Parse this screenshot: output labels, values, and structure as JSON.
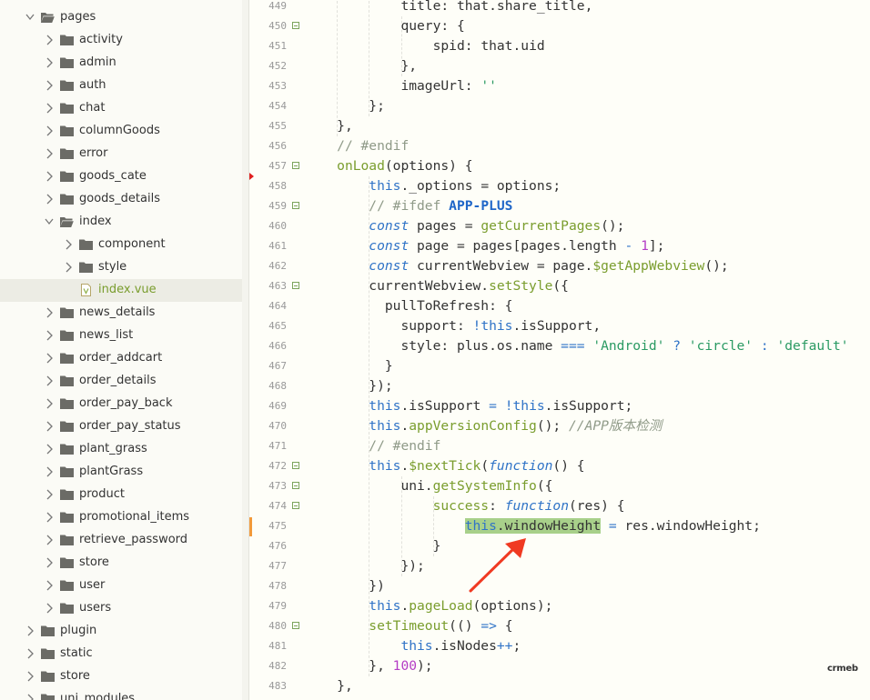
{
  "sidebar": {
    "items": [
      {
        "label": "pages",
        "level": 1,
        "type": "folder",
        "state": "expanded"
      },
      {
        "label": "activity",
        "level": 2,
        "type": "folder",
        "state": "collapsed"
      },
      {
        "label": "admin",
        "level": 2,
        "type": "folder",
        "state": "collapsed"
      },
      {
        "label": "auth",
        "level": 2,
        "type": "folder",
        "state": "collapsed"
      },
      {
        "label": "chat",
        "level": 2,
        "type": "folder",
        "state": "collapsed"
      },
      {
        "label": "columnGoods",
        "level": 2,
        "type": "folder",
        "state": "collapsed"
      },
      {
        "label": "error",
        "level": 2,
        "type": "folder",
        "state": "collapsed"
      },
      {
        "label": "goods_cate",
        "level": 2,
        "type": "folder",
        "state": "collapsed"
      },
      {
        "label": "goods_details",
        "level": 2,
        "type": "folder",
        "state": "collapsed"
      },
      {
        "label": "index",
        "level": 2,
        "type": "folder",
        "state": "expanded"
      },
      {
        "label": "component",
        "level": 3,
        "type": "folder",
        "state": "collapsed"
      },
      {
        "label": "style",
        "level": 3,
        "type": "folder",
        "state": "collapsed"
      },
      {
        "label": "index.vue",
        "level": 3,
        "type": "file",
        "state": "selected"
      },
      {
        "label": "news_details",
        "level": 2,
        "type": "folder",
        "state": "collapsed"
      },
      {
        "label": "news_list",
        "level": 2,
        "type": "folder",
        "state": "collapsed"
      },
      {
        "label": "order_addcart",
        "level": 2,
        "type": "folder",
        "state": "collapsed"
      },
      {
        "label": "order_details",
        "level": 2,
        "type": "folder",
        "state": "collapsed"
      },
      {
        "label": "order_pay_back",
        "level": 2,
        "type": "folder",
        "state": "collapsed"
      },
      {
        "label": "order_pay_status",
        "level": 2,
        "type": "folder",
        "state": "collapsed"
      },
      {
        "label": "plant_grass",
        "level": 2,
        "type": "folder",
        "state": "collapsed"
      },
      {
        "label": "plantGrass",
        "level": 2,
        "type": "folder",
        "state": "collapsed"
      },
      {
        "label": "product",
        "level": 2,
        "type": "folder",
        "state": "collapsed"
      },
      {
        "label": "promotional_items",
        "level": 2,
        "type": "folder",
        "state": "collapsed"
      },
      {
        "label": "retrieve_password",
        "level": 2,
        "type": "folder",
        "state": "collapsed"
      },
      {
        "label": "store",
        "level": 2,
        "type": "folder",
        "state": "collapsed"
      },
      {
        "label": "user",
        "level": 2,
        "type": "folder",
        "state": "collapsed"
      },
      {
        "label": "users",
        "level": 2,
        "type": "folder",
        "state": "collapsed"
      },
      {
        "label": "plugin",
        "level": 1,
        "type": "folder",
        "state": "collapsed"
      },
      {
        "label": "static",
        "level": 1,
        "type": "folder",
        "state": "collapsed"
      },
      {
        "label": "store",
        "level": 1,
        "type": "folder",
        "state": "collapsed"
      },
      {
        "label": "uni_modules",
        "level": 1,
        "type": "folder",
        "state": "collapsed"
      }
    ]
  },
  "editor": {
    "lines": [
      {
        "num": "449",
        "fold": false,
        "tokens": [
          [
            "            ",
            ""
          ],
          [
            "title",
            ""
          ],
          [
            ": ",
            ""
          ],
          [
            "that",
            ""
          ],
          [
            ".",
            ""
          ],
          [
            "share_title",
            ""
          ],
          [
            ",",
            ""
          ]
        ]
      },
      {
        "num": "450",
        "fold": true,
        "tokens": [
          [
            "            ",
            ""
          ],
          [
            "query",
            ""
          ],
          [
            ": {",
            ""
          ]
        ]
      },
      {
        "num": "451",
        "fold": false,
        "tokens": [
          [
            "                ",
            ""
          ],
          [
            "spid",
            ""
          ],
          [
            ": ",
            ""
          ],
          [
            "that",
            ""
          ],
          [
            ".",
            ""
          ],
          [
            "uid",
            ""
          ]
        ]
      },
      {
        "num": "452",
        "fold": false,
        "tokens": [
          [
            "            ",
            ""
          ],
          [
            "},",
            ""
          ]
        ]
      },
      {
        "num": "453",
        "fold": false,
        "tokens": [
          [
            "            ",
            ""
          ],
          [
            "imageUrl",
            ""
          ],
          [
            ": ",
            ""
          ],
          [
            "''",
            "t-str"
          ]
        ]
      },
      {
        "num": "454",
        "fold": false,
        "tokens": [
          [
            "        ",
            ""
          ],
          [
            "};",
            ""
          ]
        ]
      },
      {
        "num": "455",
        "fold": false,
        "tokens": [
          [
            "    ",
            ""
          ],
          [
            "},",
            ""
          ]
        ]
      },
      {
        "num": "456",
        "fold": false,
        "tokens": [
          [
            "    ",
            ""
          ],
          [
            "// #endif",
            "t-cmt"
          ]
        ]
      },
      {
        "num": "457",
        "fold": true,
        "tokens": [
          [
            "    ",
            ""
          ],
          [
            "onLoad",
            "t-fn"
          ],
          [
            "(options) {",
            ""
          ]
        ]
      },
      {
        "num": "458",
        "fold": false,
        "tokens": [
          [
            "        ",
            ""
          ],
          [
            "this",
            "t-kw"
          ],
          [
            "._options = options;",
            ""
          ]
        ]
      },
      {
        "num": "459",
        "fold": true,
        "tokens": [
          [
            "        ",
            ""
          ],
          [
            "// #ifdef ",
            "t-cmt"
          ],
          [
            "APP-PLUS",
            "t-pre"
          ]
        ]
      },
      {
        "num": "460",
        "fold": false,
        "tokens": [
          [
            "        ",
            ""
          ],
          [
            "const",
            "t-kwi"
          ],
          [
            " pages = ",
            ""
          ],
          [
            "getCurrentPages",
            "t-fn"
          ],
          [
            "();",
            ""
          ]
        ]
      },
      {
        "num": "461",
        "fold": false,
        "tokens": [
          [
            "        ",
            ""
          ],
          [
            "const",
            "t-kwi"
          ],
          [
            " page = pages[pages.length ",
            ""
          ],
          [
            "-",
            "t-op"
          ],
          [
            " ",
            ""
          ],
          [
            "1",
            "t-num"
          ],
          [
            "];",
            ""
          ]
        ]
      },
      {
        "num": "462",
        "fold": false,
        "tokens": [
          [
            "        ",
            ""
          ],
          [
            "const",
            "t-kwi"
          ],
          [
            " currentWebview = page.",
            ""
          ],
          [
            "$getAppWebview",
            "t-fn"
          ],
          [
            "();",
            ""
          ]
        ]
      },
      {
        "num": "463",
        "fold": true,
        "tokens": [
          [
            "        ",
            ""
          ],
          [
            "currentWebview.",
            ""
          ],
          [
            "setStyle",
            "t-fn"
          ],
          [
            "({",
            ""
          ]
        ]
      },
      {
        "num": "464",
        "fold": false,
        "tokens": [
          [
            "          ",
            ""
          ],
          [
            "pullToRefresh: {",
            ""
          ]
        ]
      },
      {
        "num": "465",
        "fold": false,
        "tokens": [
          [
            "            ",
            ""
          ],
          [
            "support: ",
            ""
          ],
          [
            "!",
            "t-op"
          ],
          [
            "this",
            "t-kw"
          ],
          [
            ".isSupport,",
            ""
          ]
        ]
      },
      {
        "num": "466",
        "fold": false,
        "tokens": [
          [
            "            ",
            ""
          ],
          [
            "style: plus.os.name ",
            ""
          ],
          [
            "===",
            "t-op"
          ],
          [
            " ",
            ""
          ],
          [
            "'Android'",
            "t-str"
          ],
          [
            " ",
            ""
          ],
          [
            "?",
            "t-op"
          ],
          [
            " ",
            ""
          ],
          [
            "'circle'",
            "t-str"
          ],
          [
            " ",
            ""
          ],
          [
            ":",
            "t-op"
          ],
          [
            " ",
            ""
          ],
          [
            "'default'",
            "t-str"
          ]
        ]
      },
      {
        "num": "467",
        "fold": false,
        "tokens": [
          [
            "          ",
            ""
          ],
          [
            "}",
            ""
          ]
        ]
      },
      {
        "num": "468",
        "fold": false,
        "tokens": [
          [
            "        ",
            ""
          ],
          [
            "});",
            ""
          ]
        ]
      },
      {
        "num": "469",
        "fold": false,
        "tokens": [
          [
            "        ",
            ""
          ],
          [
            "this",
            "t-kw"
          ],
          [
            ".isSupport ",
            ""
          ],
          [
            "=",
            "t-op"
          ],
          [
            " ",
            ""
          ],
          [
            "!",
            "t-op"
          ],
          [
            "this",
            "t-kw"
          ],
          [
            ".isSupport;",
            ""
          ]
        ]
      },
      {
        "num": "470",
        "fold": false,
        "tokens": [
          [
            "        ",
            ""
          ],
          [
            "this",
            "t-kw"
          ],
          [
            ".",
            ""
          ],
          [
            "appVersionConfig",
            "t-fn"
          ],
          [
            "(); ",
            ""
          ],
          [
            "//APP版本检测",
            "t-cmti"
          ]
        ]
      },
      {
        "num": "471",
        "fold": false,
        "tokens": [
          [
            "        ",
            ""
          ],
          [
            "// #endif",
            "t-cmt"
          ]
        ]
      },
      {
        "num": "472",
        "fold": true,
        "tokens": [
          [
            "        ",
            ""
          ],
          [
            "this",
            "t-kw"
          ],
          [
            ".",
            ""
          ],
          [
            "$nextTick",
            "t-fn"
          ],
          [
            "(",
            ""
          ],
          [
            "function",
            "t-kwi"
          ],
          [
            "() {",
            ""
          ]
        ]
      },
      {
        "num": "473",
        "fold": true,
        "tokens": [
          [
            "            ",
            ""
          ],
          [
            "uni.",
            ""
          ],
          [
            "getSystemInfo",
            "t-fn"
          ],
          [
            "({",
            ""
          ]
        ]
      },
      {
        "num": "474",
        "fold": true,
        "tokens": [
          [
            "                ",
            ""
          ],
          [
            "success",
            "t-fn"
          ],
          [
            ": ",
            ""
          ],
          [
            "function",
            "t-kwi"
          ],
          [
            "(res) {",
            ""
          ]
        ]
      },
      {
        "num": "475",
        "fold": false,
        "highlight": true,
        "tokens": [
          [
            "                    ",
            ""
          ],
          [
            "this",
            "t-kw hl"
          ],
          [
            ".windowHeight",
            "hl"
          ],
          [
            " ",
            ""
          ],
          [
            "=",
            "t-op"
          ],
          [
            " res.windowHeight;",
            ""
          ]
        ]
      },
      {
        "num": "476",
        "fold": false,
        "tokens": [
          [
            "                ",
            ""
          ],
          [
            "}",
            ""
          ]
        ]
      },
      {
        "num": "477",
        "fold": false,
        "tokens": [
          [
            "            ",
            ""
          ],
          [
            "});",
            ""
          ]
        ]
      },
      {
        "num": "478",
        "fold": false,
        "tokens": [
          [
            "        ",
            ""
          ],
          [
            "})",
            ""
          ]
        ]
      },
      {
        "num": "479",
        "fold": false,
        "tokens": [
          [
            "        ",
            ""
          ],
          [
            "this",
            "t-kw"
          ],
          [
            ".",
            ""
          ],
          [
            "pageLoad",
            "t-fn"
          ],
          [
            "(options);",
            ""
          ]
        ]
      },
      {
        "num": "480",
        "fold": true,
        "tokens": [
          [
            "        ",
            ""
          ],
          [
            "setTimeout",
            "t-fn"
          ],
          [
            "(() ",
            ""
          ],
          [
            "=>",
            "t-op"
          ],
          [
            " {",
            ""
          ]
        ]
      },
      {
        "num": "481",
        "fold": false,
        "tokens": [
          [
            "            ",
            ""
          ],
          [
            "this",
            "t-kw"
          ],
          [
            ".isNodes",
            ""
          ],
          [
            "++",
            "t-op"
          ],
          [
            ";",
            ""
          ]
        ]
      },
      {
        "num": "482",
        "fold": false,
        "tokens": [
          [
            "        ",
            ""
          ],
          [
            "}, ",
            ""
          ],
          [
            "100",
            "t-num"
          ],
          [
            ");",
            ""
          ]
        ]
      },
      {
        "num": "483",
        "fold": false,
        "tokens": [
          [
            "    ",
            ""
          ],
          [
            "},",
            ""
          ]
        ]
      }
    ]
  },
  "watermark": "crmeb",
  "colors": {
    "folder": "#6b6b66",
    "selected_file": "#7a9d2e",
    "fold_marker": "#7ba35a",
    "arrow": "#f03a22",
    "highlight": "#a8d08a"
  }
}
